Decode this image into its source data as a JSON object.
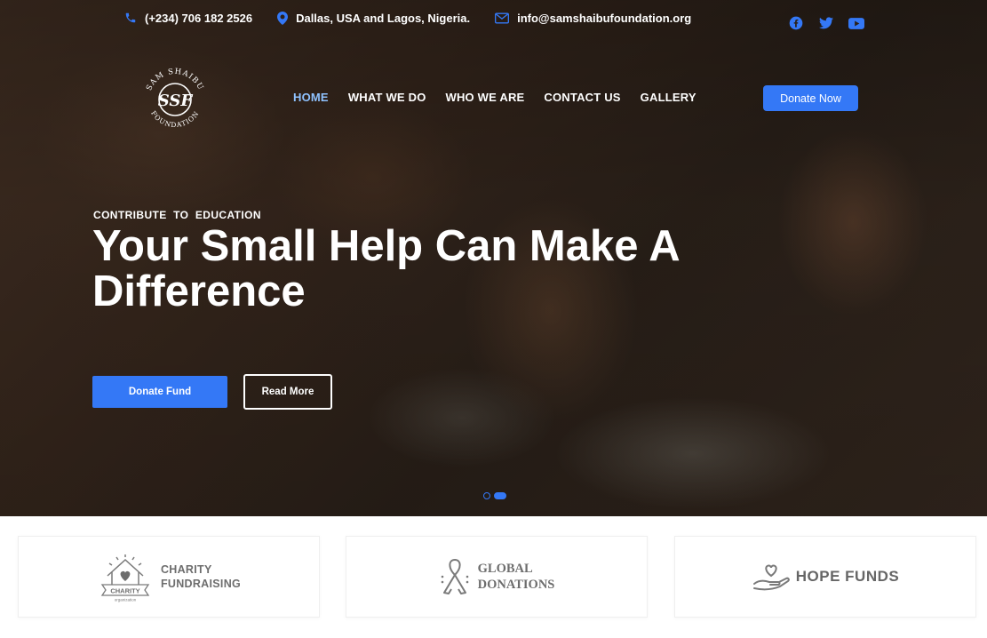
{
  "topbar": {
    "phone": "(+234) 706 182 2526",
    "location": "Dallas, USA and Lagos, Nigeria.",
    "email": "info@samshaibufoundation.org",
    "icons": [
      "phone-icon",
      "location-pin-icon",
      "envelope-icon",
      "facebook-icon",
      "twitter-icon",
      "youtube-icon"
    ]
  },
  "logo": {
    "top_text": "SAM SHAIBU",
    "monogram": "SSF",
    "bottom_text": "FOUNDATION"
  },
  "nav": {
    "items": [
      "HOME",
      "WHAT WE DO",
      "WHO WE ARE",
      "CONTACT US",
      "GALLERY"
    ],
    "active": "HOME",
    "donate_label": "Donate Now"
  },
  "hero": {
    "eyebrow": "CONTRIBUTE  TO  EDUCATION",
    "headline": "Your Small Help Can Make A Difference",
    "primary_button": "Donate Fund",
    "secondary_button": "Read More",
    "slides": 2,
    "active_slide": 2
  },
  "partners": [
    {
      "line1": "CHARITY",
      "line2": "FUNDRAISING",
      "badge": "CHARITY",
      "sub": "organization",
      "icon": "house-heart-icon"
    },
    {
      "line1": "GLOBAL",
      "line2": "DONATIONS",
      "icon": "ribbon-icon"
    },
    {
      "line1": "HOPE FUNDS",
      "icon": "hand-heart-icon"
    }
  ],
  "colors": {
    "accent": "#3478f6",
    "active_nav": "#8fc2ff",
    "partner_text": "#6d6d6d"
  }
}
